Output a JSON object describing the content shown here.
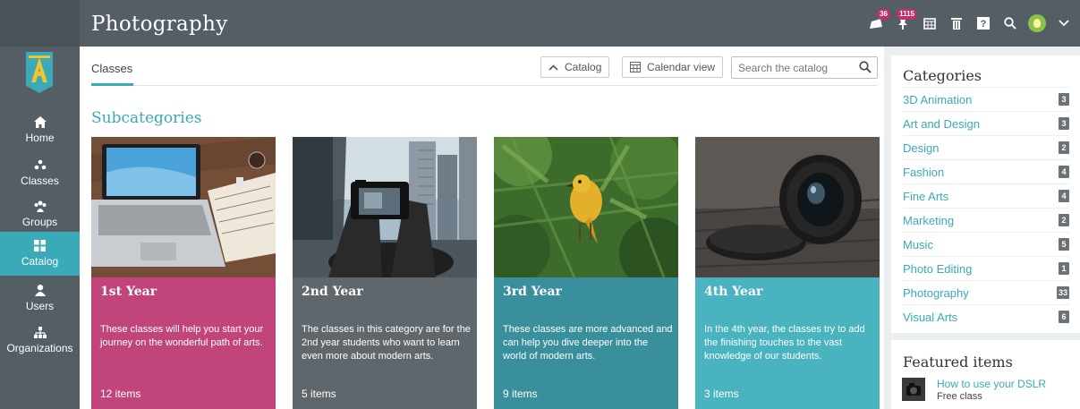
{
  "header": {
    "title": "Photography",
    "notifications_badge": "36",
    "alerts_badge": "1115"
  },
  "sidebar": {
    "items": [
      {
        "label": "Home",
        "icon": "home-icon"
      },
      {
        "label": "Classes",
        "icon": "classes-icon"
      },
      {
        "label": "Groups",
        "icon": "groups-icon"
      },
      {
        "label": "Catalog",
        "icon": "catalog-icon",
        "active": true
      },
      {
        "label": "Users",
        "icon": "users-icon"
      },
      {
        "label": "Organizations",
        "icon": "organizations-icon"
      }
    ]
  },
  "main": {
    "tab": "Classes",
    "catalog_button": "Catalog",
    "calendar_button": "Calendar view",
    "search_placeholder": "Search the catalog",
    "subcategories_title": "Subcategories",
    "cards": [
      {
        "title": "1st Year",
        "description": "These classes will help you start your journey on the wonderful path of arts.",
        "count": "12 items",
        "color": "#c1457a"
      },
      {
        "title": "2nd Year",
        "description": "The classes in this category are for the 2nd year students who want to learn even more about modern arts.",
        "count": "5 items",
        "color": "#5f666c"
      },
      {
        "title": "3rd Year",
        "description": "These classes are more advanced and can help you dive deeper into the world of modern arts.",
        "count": "9 items",
        "color": "#3a8f9c"
      },
      {
        "title": "4th Year",
        "description": "In the 4th year, the classes try to add the finishing touches to the vast knowledge of our students.",
        "count": "3 items",
        "color": "#49b3bf"
      }
    ]
  },
  "categories": {
    "title": "Categories",
    "items": [
      {
        "name": "3D Animation",
        "count": "3"
      },
      {
        "name": "Art and Design",
        "count": "3"
      },
      {
        "name": "Design",
        "count": "2"
      },
      {
        "name": "Fashion",
        "count": "4"
      },
      {
        "name": "Fine Arts",
        "count": "4"
      },
      {
        "name": "Marketing",
        "count": "2"
      },
      {
        "name": "Music",
        "count": "5"
      },
      {
        "name": "Photo Editing",
        "count": "1"
      },
      {
        "name": "Photography",
        "count": "33"
      },
      {
        "name": "Visual Arts",
        "count": "6"
      }
    ]
  },
  "featured": {
    "title": "Featured items",
    "item_title": "How to use your DSLR",
    "item_subtitle": "Free class"
  },
  "colors": {
    "accent": "#3aa9b8",
    "topbar": "#555d65",
    "badge": "#c0306d"
  }
}
